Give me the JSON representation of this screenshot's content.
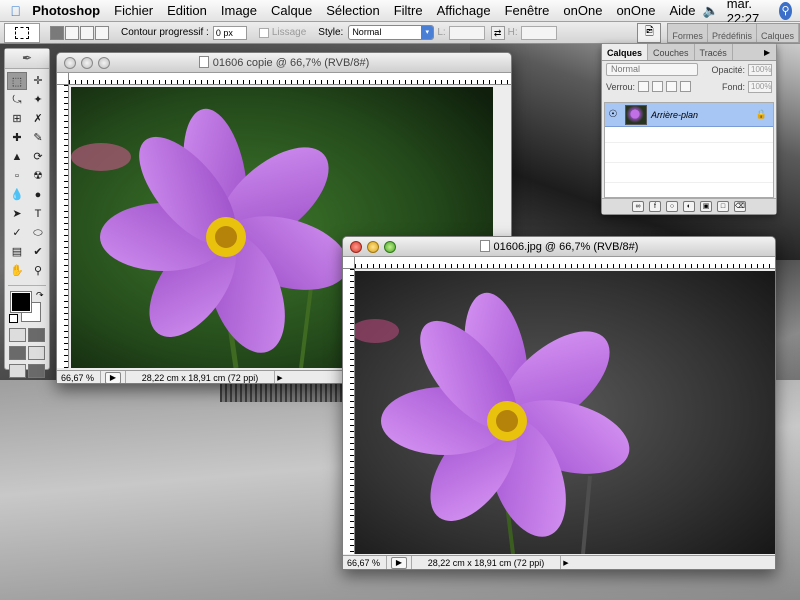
{
  "menubar": {
    "app_name": "Photoshop",
    "items": [
      "Fichier",
      "Edition",
      "Image",
      "Calque",
      "Sélection",
      "Filtre",
      "Affichage",
      "Fenêtre",
      "onOne",
      "onOne",
      "Aide"
    ],
    "clock": "mar. 22:27"
  },
  "options_bar": {
    "feather_label": "Contour progressif :",
    "feather_value": "0 px",
    "antialias_label": "Lissage",
    "style_label": "Style:",
    "style_value": "Normal",
    "width_label": "L:",
    "height_label": "H:",
    "well_tabs": [
      "Formes",
      "Prédéfinis",
      "Calques"
    ]
  },
  "doc_back": {
    "title": "01606 copie @ 66,7% (RVB/8#)",
    "zoom": "66,67 %",
    "info": "28,22 cm x 18,91 cm (72 ppi)",
    "mode": "color"
  },
  "doc_front": {
    "title": "01606.jpg @ 66,7% (RVB/8#)",
    "zoom": "66,67 %",
    "info": "28,22 cm x 18,91 cm (72 ppi)",
    "mode": "selective-color"
  },
  "layers_panel": {
    "tabs": [
      "Calques",
      "Couches",
      "Tracés"
    ],
    "blend_mode": "Normal",
    "opacity_label": "Opacité:",
    "opacity_value": "100%",
    "lock_label": "Verrou:",
    "fill_label": "Fond:",
    "fill_value": "100%",
    "layer_name": "Arrière-plan"
  },
  "colors": {
    "flower_petal": "#b86ed8",
    "flower_center": "#e9c20e",
    "selection_blue": "#a8c6f4"
  },
  "icons": {
    "apple": "apple-logo-icon",
    "volume": "speaker-icon",
    "spotlight": "spotlight-icon"
  }
}
